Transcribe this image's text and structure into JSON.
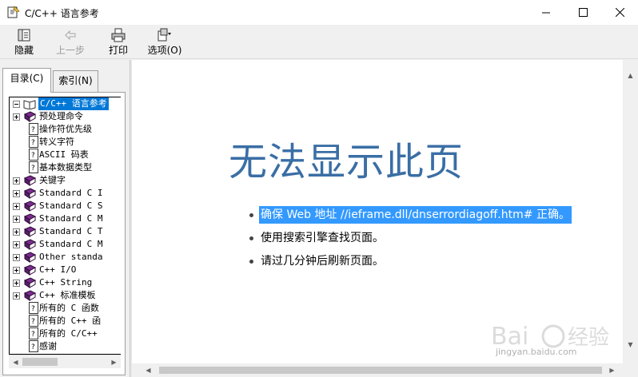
{
  "window": {
    "title": "C/C++ 语言参考",
    "minimize_glyph": "—",
    "maximize_glyph": "☐",
    "close_glyph": "✕"
  },
  "toolbar": {
    "hide_label": "隐藏",
    "back_label": "上一步",
    "print_label": "打印",
    "options_label": "选项(O)"
  },
  "tabs": {
    "contents_label": "目录(C)",
    "index_label": "索引(N)"
  },
  "tree": {
    "items": [
      {
        "label": "C/C++ 语言参考",
        "kind": "book-open",
        "expander": "minus"
      },
      {
        "label": "预处理命令",
        "kind": "book",
        "expander": "plus"
      },
      {
        "label": "操作符优先级",
        "kind": "page",
        "expander": ""
      },
      {
        "label": "转义字符",
        "kind": "page",
        "expander": ""
      },
      {
        "label": "ASCII 码表",
        "kind": "page",
        "expander": ""
      },
      {
        "label": "基本数据类型",
        "kind": "page",
        "expander": ""
      },
      {
        "label": "关键字",
        "kind": "book",
        "expander": "plus"
      },
      {
        "label": "Standard C I",
        "kind": "book",
        "expander": "plus"
      },
      {
        "label": "Standard C S",
        "kind": "book",
        "expander": "plus"
      },
      {
        "label": "Standard C M",
        "kind": "book",
        "expander": "plus"
      },
      {
        "label": "Standard C T",
        "kind": "book",
        "expander": "plus"
      },
      {
        "label": "Standard C M",
        "kind": "book",
        "expander": "plus"
      },
      {
        "label": "Other standa",
        "kind": "book",
        "expander": "plus"
      },
      {
        "label": "C++ I/O",
        "kind": "book",
        "expander": "plus"
      },
      {
        "label": "C++ String",
        "kind": "book",
        "expander": "plus"
      },
      {
        "label": "C++ 标准模板",
        "kind": "book",
        "expander": "plus"
      },
      {
        "label": "所有的 C 函数",
        "kind": "page",
        "expander": ""
      },
      {
        "label": "所有的 C++ 函",
        "kind": "page",
        "expander": ""
      },
      {
        "label": "所有的 C/C++",
        "kind": "page",
        "expander": ""
      },
      {
        "label": "感谢",
        "kind": "page",
        "expander": ""
      }
    ]
  },
  "content": {
    "heading": "无法显示此页",
    "bullets": [
      {
        "text": "确保 Web 地址 //ieframe.dll/dnserrordiagoff.htm# 正确。",
        "selected": true
      },
      {
        "text": "使用搜索引擎查找页面。",
        "selected": false
      },
      {
        "text": "请过几分钟后刷新页面。",
        "selected": false
      }
    ]
  },
  "watermark": {
    "text": "jingyan.baidu.com"
  },
  "colors": {
    "heading": "#3a6ea5",
    "selection": "#3399ff",
    "tree_selection": "#0078d7",
    "book": "#7b2d8e"
  }
}
